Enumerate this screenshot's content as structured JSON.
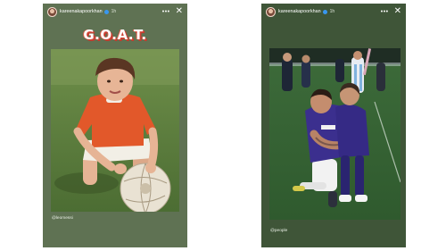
{
  "stories": [
    {
      "username": "kareenakapoorkhan",
      "time": "1h",
      "sticker_text": "G.O.A.T.",
      "photo_tag": "@leomessi"
    },
    {
      "username": "kareenakapoorkhan",
      "time": "1h",
      "photo_tag": "@people"
    }
  ],
  "icons": {
    "more": "more-options-icon",
    "close": "close-icon",
    "verified": "verified-badge-icon"
  },
  "colors": {
    "left_story_bg": "#5f7253",
    "right_story_bg": "#3f5538",
    "sticker_red": "#d24a3a",
    "verified_blue": "#3897f0"
  }
}
